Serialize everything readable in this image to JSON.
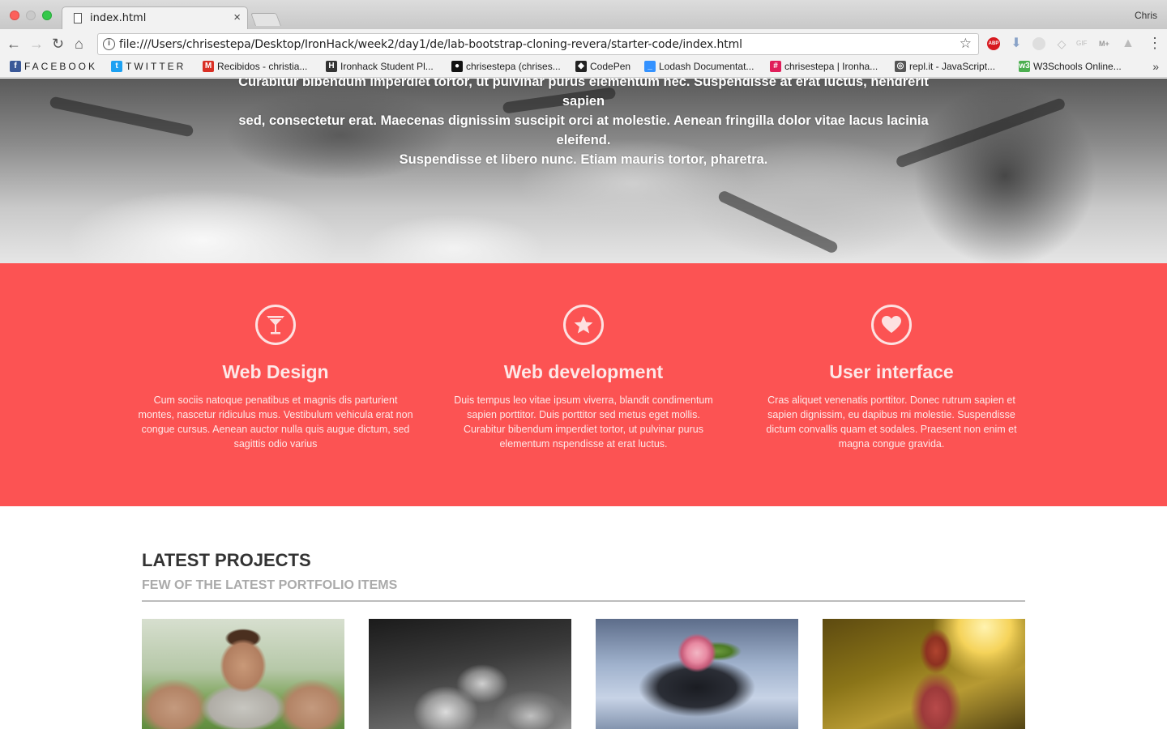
{
  "browser": {
    "tab_title": "index.html",
    "tab_close": "×",
    "profile_name": "Chris",
    "url": "file:///Users/chrisestepa/Desktop/IronHack/week2/day1/de/lab-bootstrap-cloning-revera/starter-code/index.html",
    "nav": {
      "back": "←",
      "forward": "→",
      "reload": "↻",
      "home": "⌂",
      "menu": "⋮",
      "star": "☆"
    },
    "extensions": {
      "abp": "ABP",
      "down": "⬇",
      "dropbox": "◇",
      "gif": "GIF",
      "mplus": "M+",
      "drive": "▲"
    },
    "bookmarks": [
      {
        "label": "FACEBOOK",
        "icon": "facebook-icon",
        "color": "#3b5998",
        "glyph": "f"
      },
      {
        "label": "TWITTER",
        "icon": "twitter-icon",
        "color": "#1da1f2",
        "glyph": "t"
      },
      {
        "label": "Recibidos - christia...",
        "icon": "gmail-icon",
        "color": "#d93025",
        "glyph": "M"
      },
      {
        "label": "Ironhack Student Pl...",
        "icon": "ironhack-icon",
        "color": "#333333",
        "glyph": "H"
      },
      {
        "label": "chrisestepa (chrises...",
        "icon": "github-icon",
        "color": "#111111",
        "glyph": "●"
      },
      {
        "label": "CodePen",
        "icon": "codepen-icon",
        "color": "#222222",
        "glyph": "◆"
      },
      {
        "label": "Lodash Documentat...",
        "icon": "lodash-icon",
        "color": "#3492ff",
        "glyph": "_"
      },
      {
        "label": "chrisestepa | Ironha...",
        "icon": "slack-icon",
        "color": "#e01e5a",
        "glyph": "#"
      },
      {
        "label": "repl.it - JavaScript...",
        "icon": "replit-icon",
        "color": "#555555",
        "glyph": "◎"
      },
      {
        "label": "W3Schools Online...",
        "icon": "w3schools-icon",
        "color": "#4caf50",
        "glyph": "w3"
      }
    ],
    "bookmarks_more": "»"
  },
  "hero": {
    "text_line1": "Curabitur bibendum imperdiet tortor, ut pulvinar purus elementum nec. Suspendisse at erat luctus, hendrerit sapien",
    "text_line2": "sed, consectetur erat. Maecenas dignissim suscipit orci at molestie. Aenean fringilla dolor vitae lacus lacinia eleifend.",
    "text_line3": "Suspendisse et libero nunc. Etiam mauris tortor, pharetra."
  },
  "services": {
    "background": "#fc5353",
    "items": [
      {
        "icon": "cocktail-icon",
        "title": "Web Design",
        "text": "Cum sociis natoque penatibus et magnis dis parturient montes, nascetur ridiculus mus. Vestibulum vehicula erat non congue cursus. Aenean auctor nulla quis augue dictum, sed sagittis odio varius"
      },
      {
        "icon": "star-icon",
        "title": "Web development",
        "text": "Duis tempus leo vitae ipsum viverra, blandit condimentum sapien porttitor. Duis porttitor sed metus eget mollis. Curabitur bibendum imperdiet tortor, ut pulvinar purus elementum nspendisse at erat luctus."
      },
      {
        "icon": "heart-icon",
        "title": "User interface",
        "text": "Cras aliquet venenatis porttitor. Donec rutrum sapien et sapien dignissim, eu dapibus mi molestie. Suspendisse dictum convallis quam et sodales. Praesent non enim et magna congue gravida."
      }
    ]
  },
  "projects": {
    "title": "LATEST PROJECTS",
    "subtitle": "FEW OF THE LATEST PORTFOLIO ITEMS"
  }
}
